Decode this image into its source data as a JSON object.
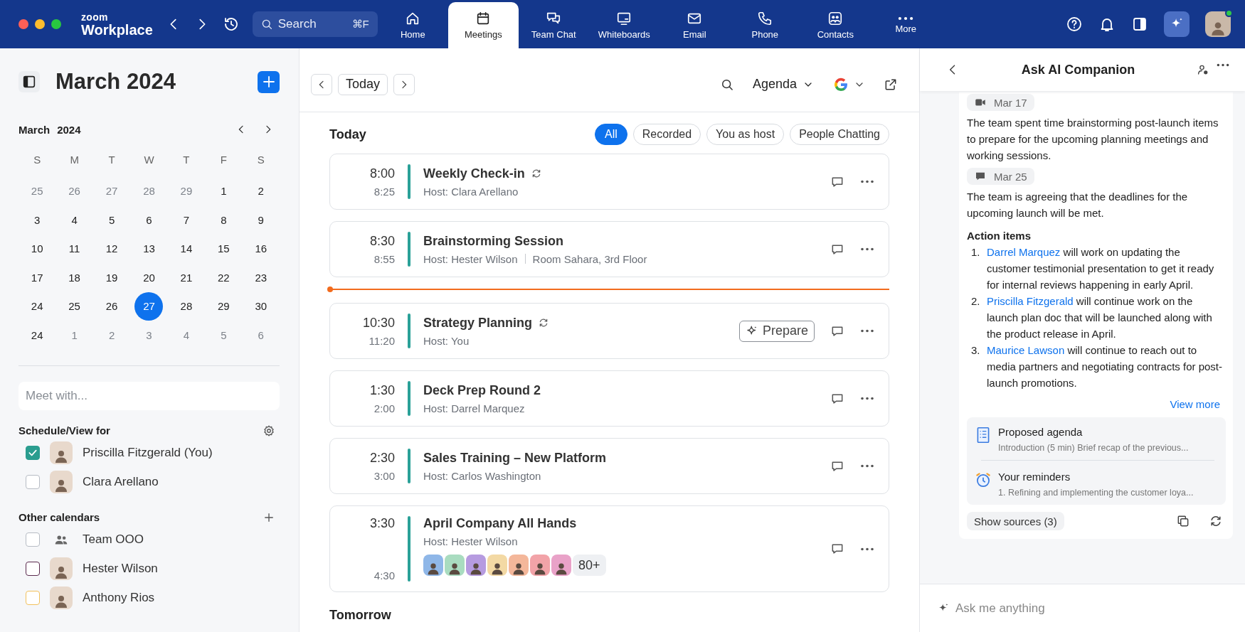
{
  "app": {
    "brand_top": "zoom",
    "brand_bottom": "Workplace",
    "search": {
      "placeholder": "Search",
      "shortcut": "⌘F"
    }
  },
  "nav_tabs": [
    {
      "label": "Home",
      "selected": false
    },
    {
      "label": "Meetings",
      "selected": true
    },
    {
      "label": "Team Chat",
      "selected": false
    },
    {
      "label": "Whiteboards",
      "selected": false
    },
    {
      "label": "Email",
      "selected": false
    },
    {
      "label": "Phone",
      "selected": false
    },
    {
      "label": "Contacts",
      "selected": false
    },
    {
      "label": "More",
      "selected": false
    }
  ],
  "sidebar": {
    "title": "March 2024",
    "mini_calendar": {
      "month": "March",
      "year": "2024",
      "weekdays": [
        "S",
        "M",
        "T",
        "W",
        "T",
        "F",
        "S"
      ],
      "weeks": [
        [
          {
            "day": "25",
            "muted": true,
            "selected": false
          },
          {
            "day": "26",
            "muted": true,
            "selected": false
          },
          {
            "day": "27",
            "muted": true,
            "selected": false
          },
          {
            "day": "28",
            "muted": true,
            "selected": false
          },
          {
            "day": "29",
            "muted": true,
            "selected": false
          },
          {
            "day": "1",
            "muted": false,
            "selected": false
          },
          {
            "day": "2",
            "muted": false,
            "selected": false
          }
        ],
        [
          {
            "day": "3",
            "muted": false,
            "selected": false
          },
          {
            "day": "4",
            "muted": false,
            "selected": false
          },
          {
            "day": "5",
            "muted": false,
            "selected": false
          },
          {
            "day": "6",
            "muted": false,
            "selected": false
          },
          {
            "day": "7",
            "muted": false,
            "selected": false
          },
          {
            "day": "8",
            "muted": false,
            "selected": false
          },
          {
            "day": "9",
            "muted": false,
            "selected": false
          }
        ],
        [
          {
            "day": "10",
            "muted": false,
            "selected": false
          },
          {
            "day": "11",
            "muted": false,
            "selected": false
          },
          {
            "day": "12",
            "muted": false,
            "selected": false
          },
          {
            "day": "13",
            "muted": false,
            "selected": false
          },
          {
            "day": "14",
            "muted": false,
            "selected": false
          },
          {
            "day": "15",
            "muted": false,
            "selected": false
          },
          {
            "day": "16",
            "muted": false,
            "selected": false
          }
        ],
        [
          {
            "day": "17",
            "muted": false,
            "selected": false
          },
          {
            "day": "18",
            "muted": false,
            "selected": false
          },
          {
            "day": "19",
            "muted": false,
            "selected": false
          },
          {
            "day": "20",
            "muted": false,
            "selected": false
          },
          {
            "day": "21",
            "muted": false,
            "selected": false
          },
          {
            "day": "22",
            "muted": false,
            "selected": false
          },
          {
            "day": "23",
            "muted": false,
            "selected": false
          }
        ],
        [
          {
            "day": "24",
            "muted": false,
            "selected": false
          },
          {
            "day": "25",
            "muted": false,
            "selected": false
          },
          {
            "day": "26",
            "muted": false,
            "selected": false
          },
          {
            "day": "27",
            "muted": false,
            "selected": true
          },
          {
            "day": "28",
            "muted": false,
            "selected": false
          },
          {
            "day": "29",
            "muted": false,
            "selected": false
          },
          {
            "day": "30",
            "muted": false,
            "selected": false
          }
        ],
        [
          {
            "day": "24",
            "muted": false,
            "selected": false
          },
          {
            "day": "1",
            "muted": true,
            "selected": false
          },
          {
            "day": "2",
            "muted": true,
            "selected": false
          },
          {
            "day": "3",
            "muted": true,
            "selected": false
          },
          {
            "day": "4",
            "muted": true,
            "selected": false
          },
          {
            "day": "5",
            "muted": true,
            "selected": false
          },
          {
            "day": "6",
            "muted": true,
            "selected": false
          }
        ]
      ]
    },
    "meet_with": {
      "placeholder": "Meet with..."
    },
    "schedule_for": {
      "heading": "Schedule/View for",
      "people": [
        {
          "name": "Priscilla Fitzgerald (You)",
          "checked": true,
          "kind": "person",
          "color": "#2a9d8f"
        },
        {
          "name": "Clara Arellano",
          "checked": false,
          "kind": "person",
          "color": "#b7bcc4"
        }
      ]
    },
    "other_calendars": {
      "heading": "Other calendars",
      "items": [
        {
          "name": "Team OOO",
          "checked": false,
          "kind": "group",
          "color": "#b7bcc4"
        },
        {
          "name": "Hester Wilson",
          "checked": false,
          "kind": "person",
          "color": "#5b2a4e"
        },
        {
          "name": "Anthony Rios",
          "checked": false,
          "kind": "person",
          "color": "#f2c15c"
        }
      ]
    }
  },
  "agenda": {
    "today_button": "Today",
    "view": "Agenda",
    "section": "Today",
    "filters": [
      {
        "label": "All",
        "selected": true
      },
      {
        "label": "Recorded",
        "selected": false
      },
      {
        "label": "You as host",
        "selected": false
      },
      {
        "label": "People Chatting",
        "selected": false
      }
    ],
    "meetings": [
      {
        "start": "8:00",
        "end": "8:25",
        "title": "Weekly Check-in",
        "recurring": true,
        "host": "Host: Clara Arellano"
      },
      {
        "start": "8:30",
        "end": "8:55",
        "title": "Brainstorming Session",
        "recurring": false,
        "host": "Host: Hester Wilson",
        "location": "Room Sahara, 3rd Floor",
        "now_after": true
      },
      {
        "start": "10:30",
        "end": "11:20",
        "title": "Strategy Planning",
        "recurring": true,
        "host": "Host: You",
        "prepare": "Prepare"
      },
      {
        "start": "1:30",
        "end": "2:00",
        "title": "Deck Prep Round 2",
        "recurring": false,
        "host": "Host: Darrel Marquez"
      },
      {
        "start": "2:30",
        "end": "3:00",
        "title": "Sales Training – New Platform",
        "recurring": false,
        "host": "Host: Carlos Washington"
      },
      {
        "start": "3:30",
        "end": "4:30",
        "title": "April Company All Hands",
        "recurring": false,
        "host": "Host: Hester Wilson",
        "attendees": [
          {
            "color": "#8fb7e8"
          },
          {
            "color": "#a9dcc0"
          },
          {
            "color": "#b69be0"
          },
          {
            "color": "#f3d9a4"
          },
          {
            "color": "#f4b79a"
          },
          {
            "color": "#f2a3a8"
          },
          {
            "color": "#e9a2c8"
          }
        ],
        "attendee_more": "80+"
      }
    ],
    "next_section": "Tomorrow"
  },
  "ai_panel": {
    "title": "Ask AI Companion",
    "summaries": [
      {
        "kind": "video",
        "date": "Mar 17",
        "text": "The team spent time brainstorming post-launch items to prepare for the upcoming planning meetings and working sessions."
      },
      {
        "kind": "chat",
        "date": "Mar 25",
        "text": "The team is agreeing that the deadlines for the upcoming launch will be met."
      }
    ],
    "action_heading": "Action items",
    "action_items": [
      {
        "number": "1.",
        "person": "Darrel Marquez",
        "text": " will work on updating the customer testimonial presentation to get it ready for internal reviews happening in early April."
      },
      {
        "number": "2.",
        "person": "Priscilla Fitzgerald",
        "text": " will continue work on the launch plan doc that will be launched along with the product release in April."
      },
      {
        "number": "3.",
        "person": "Maurice Lawson",
        "text": " will continue to reach out to media partners and negotiating contracts for post-launch promotions."
      }
    ],
    "view_more": "View more",
    "suggestions": [
      {
        "kind": "agenda",
        "title": "Proposed agenda",
        "subtitle": "Introduction (5 min) Brief recap of the previous..."
      },
      {
        "kind": "reminder",
        "title": "Your reminders",
        "subtitle": "1. Refining and implementing the customer loya..."
      }
    ],
    "sources": "Show sources (3)",
    "input": {
      "placeholder": "Ask me anything"
    }
  }
}
